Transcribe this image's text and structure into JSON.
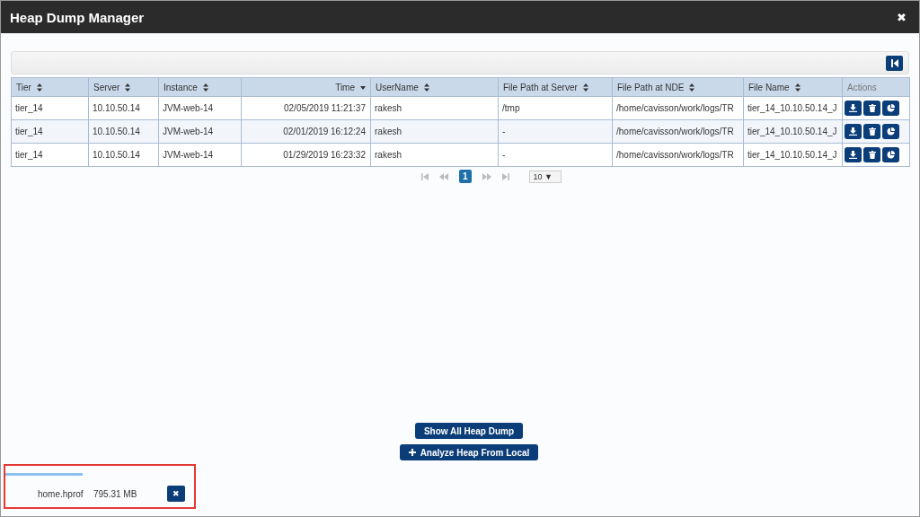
{
  "window": {
    "title": "Heap Dump Manager",
    "close": "✖"
  },
  "table": {
    "columns": [
      {
        "label": "Tier",
        "sortable": true,
        "sorted": false,
        "right_aligned": false
      },
      {
        "label": "Server",
        "sortable": true,
        "sorted": false,
        "right_aligned": false
      },
      {
        "label": "Instance",
        "sortable": true,
        "sorted": false,
        "right_aligned": false
      },
      {
        "label": "Time",
        "sortable": true,
        "sorted": true,
        "right_aligned": true
      },
      {
        "label": "UserName",
        "sortable": true,
        "sorted": false,
        "right_aligned": false
      },
      {
        "label": "File Path at Server",
        "sortable": true,
        "sorted": false,
        "right_aligned": false
      },
      {
        "label": "File Path at NDE",
        "sortable": true,
        "sorted": false,
        "right_aligned": false
      },
      {
        "label": "File Name",
        "sortable": true,
        "sorted": false,
        "right_aligned": false
      },
      {
        "label": "Actions",
        "sortable": false,
        "sorted": false,
        "right_aligned": false
      }
    ],
    "rows": [
      {
        "cells": [
          "tier_14",
          "10.10.50.14",
          "JVM-web-14",
          "02/05/2019 11:21:37",
          "rakesh",
          "/tmp",
          "/home/cavisson/work/logs/TR",
          "tier_14_10.10.50.14_J"
        ]
      },
      {
        "cells": [
          "tier_14",
          "10.10.50.14",
          "JVM-web-14",
          "02/01/2019 16:12:24",
          "rakesh",
          "-",
          "/home/cavisson/work/logs/TR",
          "tier_14_10.10.50.14_J"
        ]
      },
      {
        "cells": [
          "tier_14",
          "10.10.50.14",
          "JVM-web-14",
          "01/29/2019 16:23:32",
          "rakesh",
          "-",
          "/home/cavisson/work/logs/TR",
          "tier_14_10.10.50.14_J"
        ]
      }
    ]
  },
  "pager": {
    "pages": [
      {
        "label": "1",
        "selected": true
      }
    ],
    "page_size": "10 ▼"
  },
  "buttons": [
    {
      "label": "Show All Heap Dump",
      "icon": false
    },
    {
      "label": "Analyze Heap From Local",
      "icon": true
    }
  ],
  "upload": {
    "level": 0.41,
    "file": "home.hprof",
    "size": "795.31 MB",
    "remove": "✖"
  }
}
